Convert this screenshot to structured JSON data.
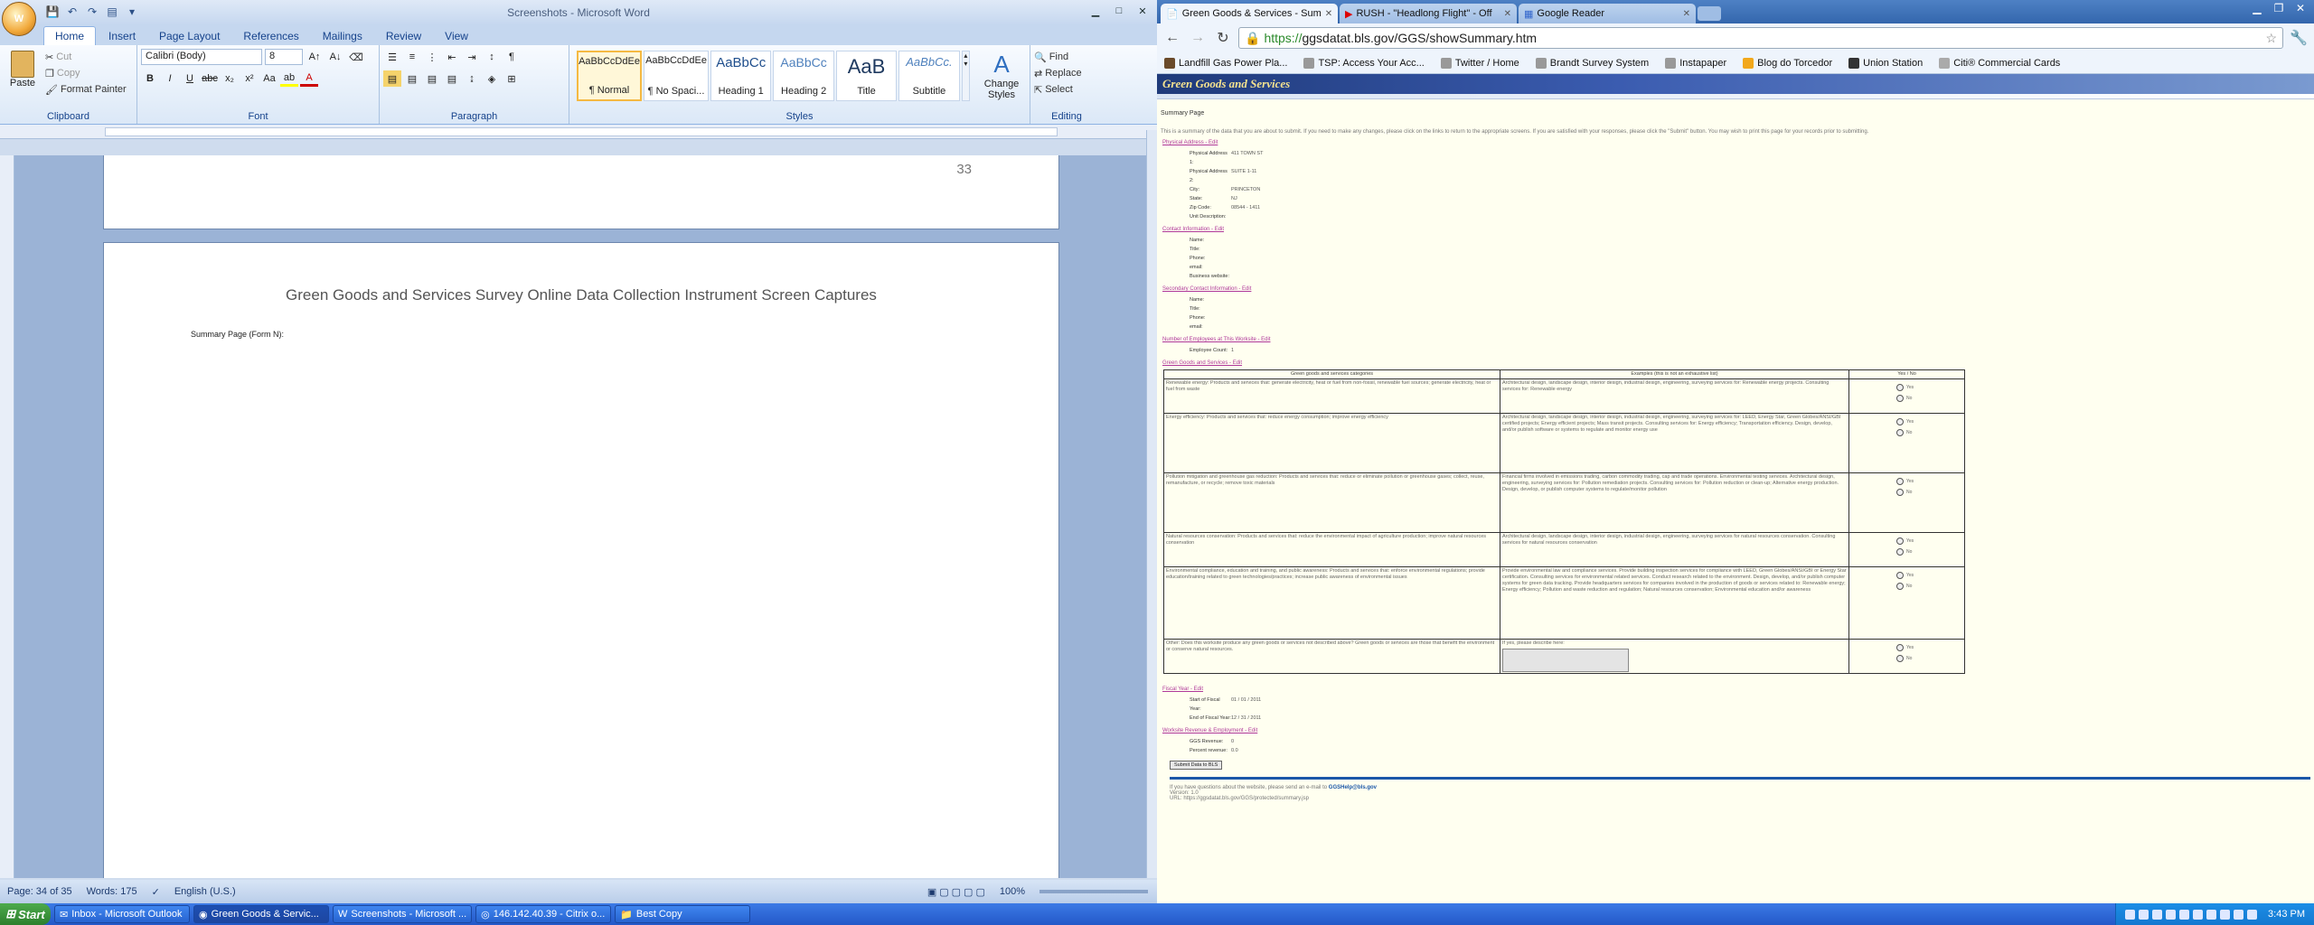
{
  "word": {
    "window_title": "Screenshots - Microsoft Word",
    "tabs": [
      "Home",
      "Insert",
      "Page Layout",
      "References",
      "Mailings",
      "Review",
      "View"
    ],
    "clipboard": {
      "paste": "Paste",
      "cut": "Cut",
      "copy": "Copy",
      "format_painter": "Format Painter",
      "label": "Clipboard"
    },
    "font": {
      "name": "Calibri (Body)",
      "size": "8",
      "label": "Font"
    },
    "paragraph_label": "Paragraph",
    "styles": [
      {
        "preview": "AaBbCcDdEe",
        "name": "¶ Normal"
      },
      {
        "preview": "AaBbCcDdEe",
        "name": "¶ No Spaci..."
      },
      {
        "preview": "AaBbCc",
        "name": "Heading 1"
      },
      {
        "preview": "AaBbCc",
        "name": "Heading 2"
      },
      {
        "preview": "AaB",
        "name": "Title"
      },
      {
        "preview": "AaBbCc.",
        "name": "Subtitle"
      }
    ],
    "styles_label": "Styles",
    "change_styles": "Change Styles",
    "editing": {
      "find": "Find",
      "replace": "Replace",
      "select": "Select",
      "label": "Editing"
    },
    "page_number": "33",
    "doc_heading": "Green Goods and Services Survey Online Data Collection Instrument Screen Captures",
    "doc_subheading": "Summary Page (Form N):",
    "status": {
      "page": "Page: 34 of 35",
      "words": "Words: 175",
      "language": "English (U.S.)",
      "zoom": "100%"
    }
  },
  "chrome": {
    "tabs": [
      {
        "title": "Green Goods & Services - Sum",
        "icon": "page-icon",
        "active": true
      },
      {
        "title": "RUSH - \"Headlong Flight\" - Off",
        "icon": "youtube-icon",
        "active": false
      },
      {
        "title": "Google Reader",
        "icon": "google-reader-icon",
        "active": false
      }
    ],
    "url_scheme": "https://",
    "url_rest": "ggsdatat.bls.gov/GGS/showSummary.htm",
    "bookmarks": [
      "Landfill Gas Power Pla...",
      "TSP: Access Your Acc...",
      "Twitter / Home",
      "Brandt Survey System",
      "Instapaper",
      "Blog do Torcedor",
      "Union Station",
      "Citi® Commercial Cards"
    ]
  },
  "site": {
    "banner_title": "Green Goods and Services",
    "page_title": "Summary Page",
    "intro": "This is a summary of the data that you are about to submit. If you need to make any changes, please click on the links to return to the appropriate screens. If you are satisfied with your responses, please click the \"Submit\" button. You may wish to print this page for your records prior to submitting.",
    "sections": {
      "physical": "Physical Address - Edit",
      "contact": "Contact Information - Edit",
      "alt_contact": "Secondary Contact Information - Edit",
      "employees": "Number of Employees at This Worksite - Edit",
      "questions": "Green Goods and Services - Edit",
      "fiscal": "Fiscal Year - Edit",
      "revenue": "Worksite Revenue & Employment - Edit"
    },
    "address": [
      {
        "k": "Physical Address 1:",
        "v": "411 TOWN ST"
      },
      {
        "k": "Physical Address 2:",
        "v": "SUITE 1-11"
      },
      {
        "k": "City:",
        "v": "PRINCETON"
      },
      {
        "k": "State:",
        "v": "NJ"
      },
      {
        "k": "Zip Code:",
        "v": "08544 - 1411"
      },
      {
        "k": "Unit Description:",
        "v": ""
      }
    ],
    "contact": [
      {
        "k": "Name:",
        "v": ""
      },
      {
        "k": "Title:",
        "v": ""
      },
      {
        "k": "Phone:",
        "v": ""
      },
      {
        "k": "email:",
        "v": ""
      },
      {
        "k": "Business website:",
        "v": ""
      }
    ],
    "alt_contact": [
      {
        "k": "Name:",
        "v": ""
      },
      {
        "k": "Title:",
        "v": ""
      },
      {
        "k": "Phone:",
        "v": ""
      },
      {
        "k": "email:",
        "v": ""
      }
    ],
    "employee_count": {
      "k": "Employee Count:",
      "v": "1"
    },
    "table_headers": [
      "Green goods and services categories",
      "Examples (this is not an exhaustive list)",
      "Yes / No"
    ],
    "rows": [
      {
        "cat": "Renewable energy: Products and services that: generate electricity, heat or fuel from non-fossil, renewable fuel sources; generate electricity, heat or fuel from waste",
        "ex": "Architectural design, landscape design, interior design, industrial design, engineering, surveying services for: Renewable energy projects. Consulting services for: Renewable energy"
      },
      {
        "cat": "Energy efficiency: Products and services that: reduce energy consumption; improve energy efficiency",
        "ex": "Architectural design, landscape design, interior design, industrial design, engineering, surveying services for: LEED, Energy Star, Green Globes/ANSI/GBI certified projects; Energy efficient projects; Mass transit projects. Consulting services for: Energy efficiency; Transportation efficiency. Design, develop, and/or publish software or systems to regulate and monitor energy use"
      },
      {
        "cat": "Pollution mitigation and greenhouse gas reduction: Products and services that: reduce or eliminate pollution or greenhouse gases; collect, reuse, remanufacture, or recycle; remove toxic materials",
        "ex": "Financial firms involved in emissions trading, carbon commodity trading, cap and trade operations. Environmental testing services. Architectural design, engineering, surveying services for: Pollution remediation projects. Consulting services for: Pollution reduction or clean-up; Alternative energy production. Design, develop, or publish computer systems to regulate/monitor pollution"
      },
      {
        "cat": "Natural resources conservation: Products and services that: reduce the environmental impact of agriculture production; improve natural resources conservation",
        "ex": "Architectural design, landscape design, interior design, industrial design, engineering, surveying services for natural resources conservation. Consulting services for natural resources conservation"
      },
      {
        "cat": "Environmental compliance, education and training, and public awareness: Products and services that: enforce environmental regulations; provide education/training related to green technologies/practices; increase public awareness of environmental issues",
        "ex": "Provide environmental law and compliance services. Provide building inspection services for compliance with LEED, Green Globes/ANSI/GBI or Energy Star certification. Consulting services for environmental related services. Conduct research related to the environment. Design, develop, and/or publish computer systems for green data tracking. Provide headquarters services for companies involved in the production of goods or services related to: Renewable energy; Energy efficiency; Pollution and waste reduction and regulation; Natural resources conservation; Environmental education and/or awareness"
      },
      {
        "cat": "Other: Does this worksite produce any green goods or services not described above? Green goods or services are those that benefit the environment or conserve natural resources.",
        "ex": "If yes, please describe here:"
      }
    ],
    "yes_label": "Yes",
    "no_label": "No",
    "fiscal": [
      {
        "k": "Start of Fiscal Year:",
        "v": "01 / 01 / 2011"
      },
      {
        "k": "End of Fiscal Year:",
        "v": "12 / 31 / 2011"
      }
    ],
    "revenue": [
      {
        "k": "GGS Revenue:",
        "v": "0"
      },
      {
        "k": "Percent revenue:",
        "v": "0.0"
      }
    ],
    "submit": "Submit Data to BLS",
    "footer_1": "If you have questions about the website, please send an e-mail to",
    "footer_email": "GGSHelp@bls.gov",
    "footer_2": "Version: 1.0",
    "footer_3": "URL: https://ggsdatat.bls.gov/GGS/protected/summary.jsp"
  },
  "taskbar": {
    "start": "Start",
    "items": [
      "Inbox - Microsoft Outlook",
      "Green Goods & Servic...",
      "Screenshots - Microsoft ...",
      "146.142.40.39 - Citrix o...",
      "Best Copy"
    ],
    "clock": "3:43 PM"
  }
}
